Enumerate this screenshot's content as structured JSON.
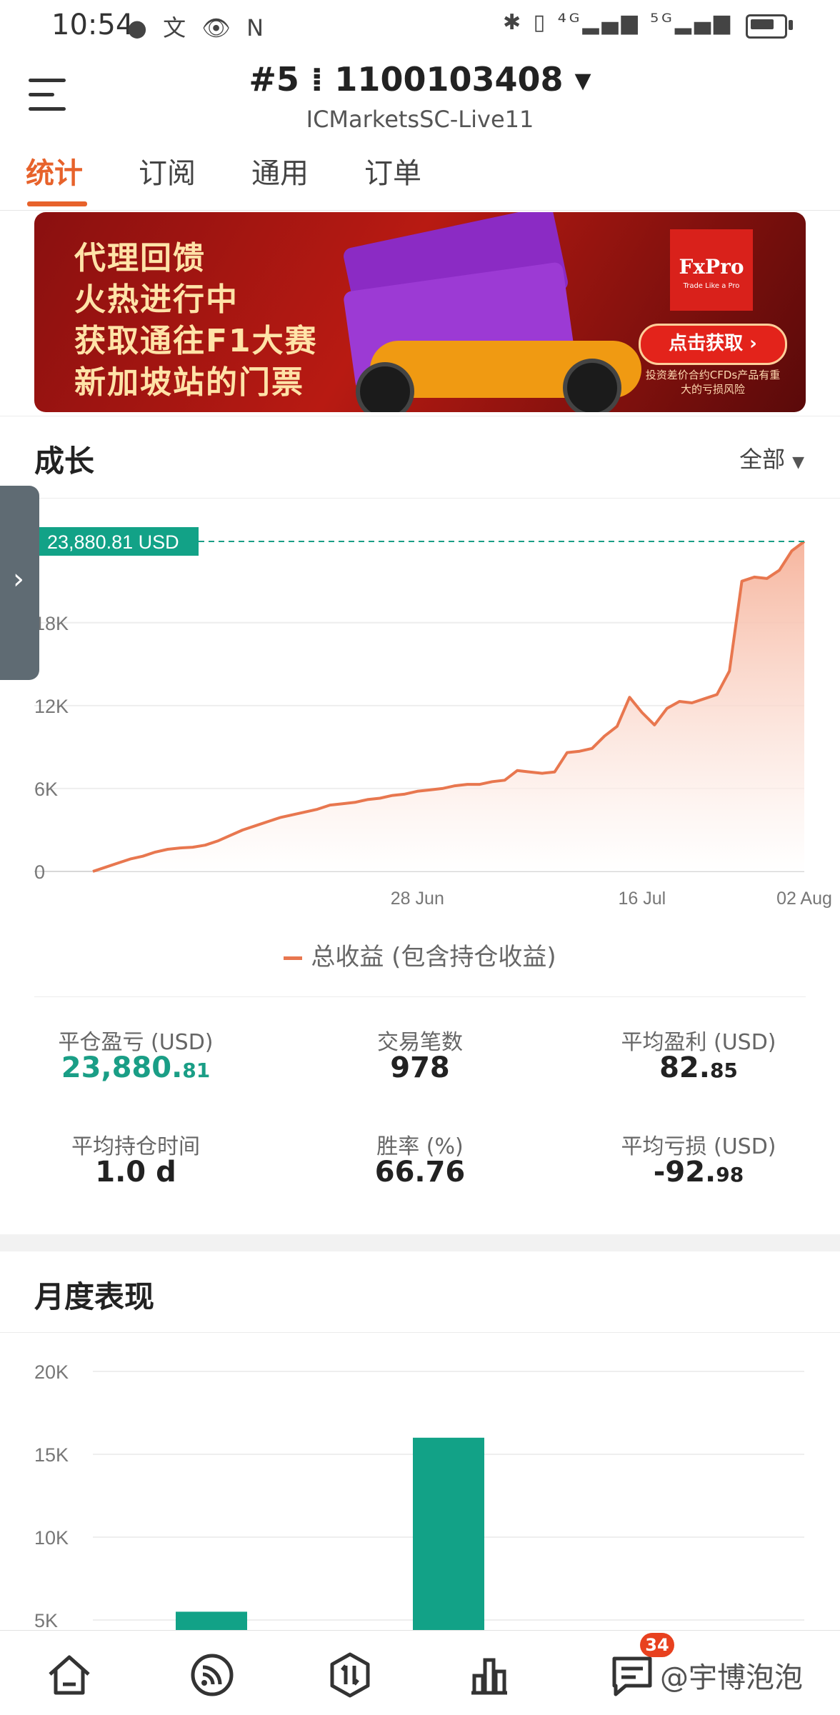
{
  "status_bar": {
    "time": "10:54",
    "left_icons": "● 文 👁 N",
    "right_icons": "✱ ▯ ⁴ᴳ▂▄▆ ⁵ᴳ▂▄▆"
  },
  "header": {
    "account_title": "#5 ⁞ 1100103408 ▾",
    "server": "ICMarketsSC-Live11"
  },
  "tabs": [
    "统计",
    "订阅",
    "通用",
    "订单"
  ],
  "banner": {
    "lines": [
      "代理回馈",
      "火热进行中",
      "获取通往F1大赛",
      "新加坡站的门票"
    ],
    "brand": "FxPro",
    "brand_tagline": "Trade Like a Pro",
    "cta": "点击获取 ›",
    "risk_note": "投资差价合约CFDs产品有重大的亏损风险",
    "colors": {
      "brand_red": "#d9211b",
      "text_gold": "#ffe3a8"
    }
  },
  "growth": {
    "title": "成长",
    "range_select": "全部",
    "legend": "总收益 (包含持仓收益)"
  },
  "chart_data": [
    {
      "type": "area",
      "title": "成长",
      "current_label": "23,880.81 USD",
      "current_value": 23880.81,
      "ylim": [
        0,
        23880.81
      ],
      "y_ticks": [
        {
          "value": 0,
          "label": "0"
        },
        {
          "value": 6000,
          "label": "6K"
        },
        {
          "value": 12000,
          "label": "12K"
        },
        {
          "value": 18000,
          "label": "18K"
        }
      ],
      "x_ticks": [
        "28 Jun",
        "16 Jul",
        "02 Aug"
      ],
      "x_range_days": [
        0,
        57
      ],
      "x_tick_days": [
        26,
        44,
        57
      ],
      "series": [
        {
          "name": "总收益 (包含持仓收益)",
          "color": "#e8774f",
          "points": [
            [
              0,
              0
            ],
            [
              1,
              300
            ],
            [
              2,
              600
            ],
            [
              3,
              900
            ],
            [
              4,
              1100
            ],
            [
              5,
              1400
            ],
            [
              6,
              1600
            ],
            [
              7,
              1700
            ],
            [
              8,
              1750
            ],
            [
              9,
              1900
            ],
            [
              10,
              2200
            ],
            [
              11,
              2600
            ],
            [
              12,
              3000
            ],
            [
              13,
              3300
            ],
            [
              14,
              3600
            ],
            [
              15,
              3900
            ],
            [
              16,
              4100
            ],
            [
              17,
              4300
            ],
            [
              18,
              4500
            ],
            [
              19,
              4800
            ],
            [
              20,
              4900
            ],
            [
              21,
              5000
            ],
            [
              22,
              5200
            ],
            [
              23,
              5300
            ],
            [
              24,
              5500
            ],
            [
              25,
              5600
            ],
            [
              26,
              5800
            ],
            [
              27,
              5900
            ],
            [
              28,
              6000
            ],
            [
              29,
              6200
            ],
            [
              30,
              6300
            ],
            [
              31,
              6300
            ],
            [
              32,
              6500
            ],
            [
              33,
              6600
            ],
            [
              34,
              7300
            ],
            [
              35,
              7200
            ],
            [
              36,
              7100
            ],
            [
              37,
              7200
            ],
            [
              38,
              8600
            ],
            [
              39,
              8700
            ],
            [
              40,
              8900
            ],
            [
              41,
              9800
            ],
            [
              42,
              10500
            ],
            [
              43,
              12600
            ],
            [
              44,
              11500
            ],
            [
              45,
              10600
            ],
            [
              46,
              11800
            ],
            [
              47,
              12300
            ],
            [
              48,
              12200
            ],
            [
              49,
              12500
            ],
            [
              50,
              12800
            ],
            [
              51,
              14500
            ],
            [
              52,
              21000
            ],
            [
              53,
              21300
            ],
            [
              54,
              21200
            ],
            [
              55,
              21800
            ],
            [
              56,
              23200
            ],
            [
              57,
              23880.81
            ]
          ]
        }
      ],
      "colors": {
        "line": "#e8774f",
        "fill_top": "#f6b29a",
        "current_line": "#1a9e86",
        "label_bg": "#12a287"
      }
    },
    {
      "type": "bar",
      "title": "月度表现",
      "ylim": [
        0,
        20000
      ],
      "y_ticks": [
        {
          "value": 5000,
          "label": "5K"
        },
        {
          "value": 10000,
          "label": "10K"
        },
        {
          "value": 15000,
          "label": "15K"
        },
        {
          "value": 20000,
          "label": "20K"
        }
      ],
      "visible_range": [
        5000,
        20000
      ],
      "values": [
        5500,
        16000
      ],
      "slot_index": [
        0,
        1
      ],
      "bar_color": "#12a287"
    }
  ],
  "stats": [
    {
      "label": "平仓盈亏 (USD)",
      "int": "23,880.",
      "dec": "81",
      "color": "#1a9e86"
    },
    {
      "label": "交易笔数",
      "int": "978",
      "dec": "",
      "color": "#222222"
    },
    {
      "label": "平均盈利 (USD)",
      "int": "82.",
      "dec": "85",
      "color": "#222222"
    },
    {
      "label": "平均持仓时间",
      "int": "1.0 d",
      "dec": "",
      "color": "#222222"
    },
    {
      "label": "胜率 (%)",
      "int": "66.76",
      "dec": "",
      "color": "#222222"
    },
    {
      "label": "平均亏损 (USD)",
      "int": "-92.",
      "dec": "98",
      "color": "#222222"
    }
  ],
  "monthly": {
    "title": "月度表现"
  },
  "bottom_nav": {
    "icons": [
      "home-icon",
      "feed-icon",
      "trade-icon",
      "chart-icon",
      "messages-icon"
    ],
    "badge": "34",
    "watermark": "@宇博泡泡"
  }
}
